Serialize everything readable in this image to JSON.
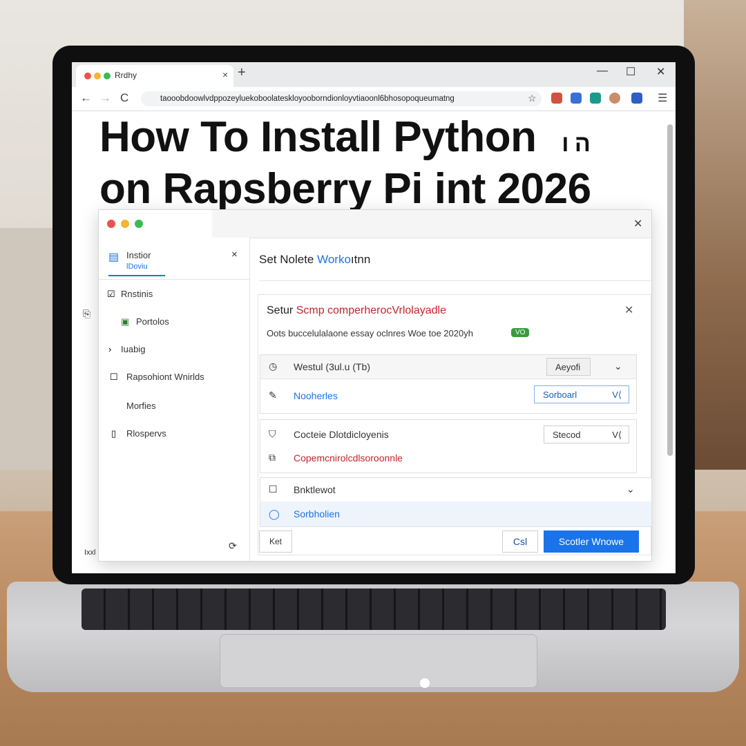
{
  "colors": {
    "accent": "#1a73e8",
    "red_text": "#c0262d",
    "badge": "#3c9b3c"
  },
  "browser": {
    "tab_title": "Rrdhy",
    "tab_close": "×",
    "new_tab": "+",
    "window_controls": [
      "—",
      "☐",
      "✕"
    ],
    "nav": [
      "←",
      "→",
      "C"
    ],
    "url": "taooobdoowlvdppozeyluekoboolateskloyooborndionloyvtiaoonl6bhosopoqueumatng",
    "icons": [
      "lock-icon",
      "star-icon",
      "extension-icon",
      "menu-icon"
    ],
    "menu": "☰"
  },
  "page": {
    "headline_line1": "How To Install Python",
    "headline_stray": "ה ו",
    "headline_line2": "on Rapsberry Pi int 2026",
    "side_fragment": "⎘",
    "footer_fragment": "Ixxl"
  },
  "dialog": {
    "close": "✕",
    "sidebar": {
      "header_title": "Instior",
      "header_sub": "lDoviu",
      "header_close": "×",
      "items": [
        {
          "label": "Rnstinis",
          "icon": "checkbox-icon"
        },
        {
          "label": "Portolos",
          "icon": "document-icon"
        },
        {
          "label": "Iuabig",
          "icon": "chevron-right-icon"
        },
        {
          "label": "Rapsohiont Wnirlds",
          "icon": "checkbox-icon"
        },
        {
          "label": "Morfies",
          "icon": ""
        },
        {
          "label": "Rlospervs",
          "icon": "page-icon"
        }
      ],
      "spinner": "⟳"
    },
    "main_title_a": "Set Nolete ",
    "main_title_b": "Worko",
    "main_title_c": "ıtnn",
    "card": {
      "title_a": "Setur ",
      "title_b": "Scmp comperherocVrlolayadle",
      "close": "✕",
      "subtitle": "Oots buccelulalaone essay oclnres Woe toe 2020yh",
      "badge": "VO",
      "group1": {
        "row1_label": "Westul (3ul.u (Tb)",
        "row1_value": "Aeyofi",
        "row1_chev": "⌄",
        "row2_label": "Nooherles",
        "row2_value": "Sorboarl",
        "row2_chev": "V⟨"
      },
      "group2": {
        "row1_label": "Cocteie Dlotdicloyenis",
        "row1_value": "Stecod",
        "row1_chev": "V⟨",
        "row2_label": "Copemcnirolcdlsoroonnle"
      },
      "group3": {
        "row1_label": "Bnktlewot",
        "row1_chev": "⌄",
        "row2_label": "Sorbholien"
      }
    },
    "buttons": {
      "small": "Ket",
      "cancel": "Csl",
      "primary": "Scotler Wnowe"
    }
  }
}
